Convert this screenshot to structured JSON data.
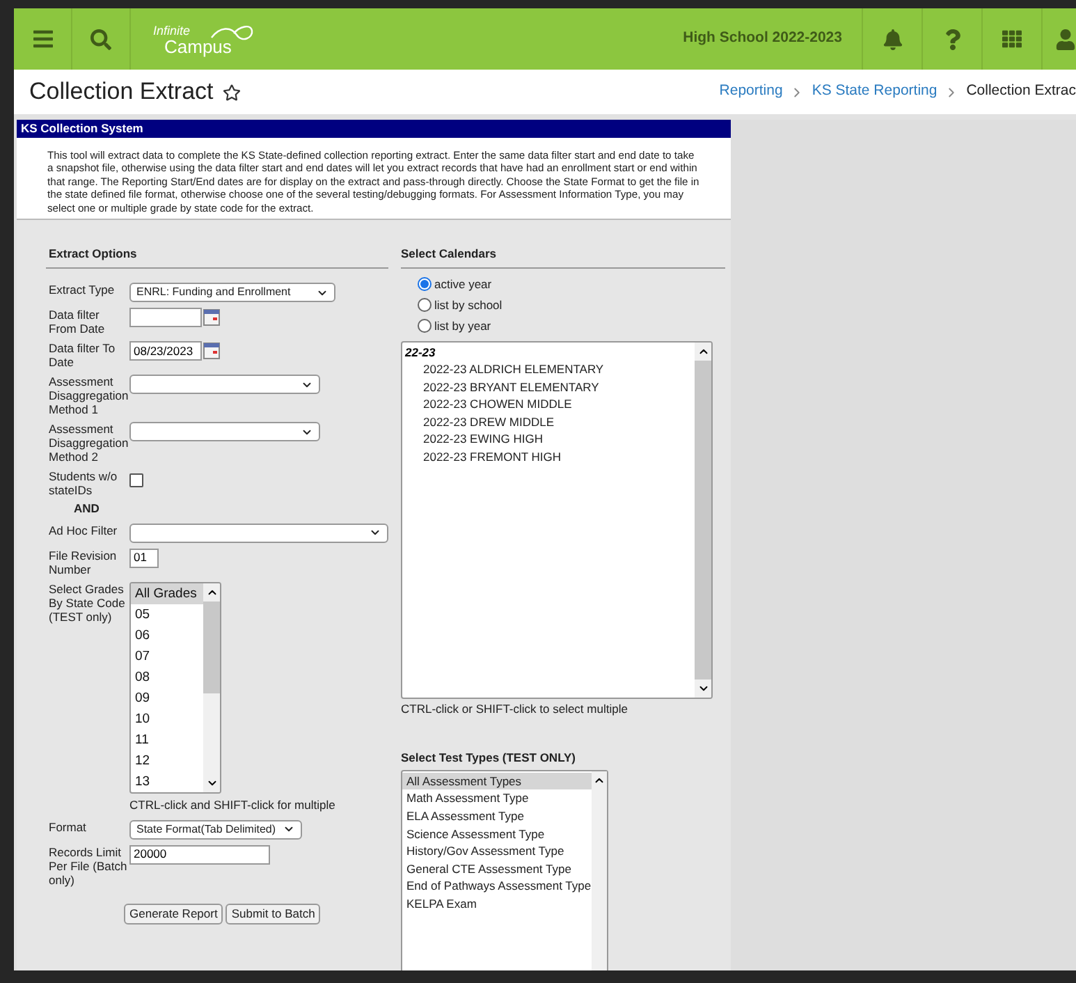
{
  "header": {
    "logo_top": "Infinite",
    "logo_bottom": "Campus",
    "school": "High School 2022-2023"
  },
  "page": {
    "title": "Collection Extract",
    "favorite": false,
    "breadcrumbs": [
      {
        "label": "Reporting",
        "link": true
      },
      {
        "label": "KS State Reporting",
        "link": true
      },
      {
        "label": "Collection Extrac",
        "link": false
      }
    ]
  },
  "panel": {
    "title": "KS Collection System",
    "description": "This tool will extract data to complete the KS State-defined collection reporting extract. Enter the same data filter start and end date to take a snapshot file, otherwise using the data filter start and end dates will let you extract records that have had an enrollment start or end within that range. The Reporting Start/End dates are for display on the extract and pass-through directly. Choose the State Format to get the file in the state defined file format, otherwise choose one of the several testing/debugging formats. For Assessment Information Type, you may select one or multiple grade by state code for the extract."
  },
  "extract_options": {
    "heading": "Extract Options",
    "fields": [
      {
        "kind": "select",
        "label": "Extract Type",
        "value": "ENRL: Funding and Enrollment"
      },
      {
        "kind": "date",
        "label": "Data filter From Date"
      },
      {
        "kind": "date",
        "label": "Data filter To Date",
        "value": "08/23/2023"
      },
      {
        "kind": "select",
        "label": "Assessment Disaggregation Method 1"
      },
      {
        "kind": "select",
        "label": "Assessment Disaggregation Method 2"
      },
      {
        "kind": "checkbox",
        "label": "Students w/o stateIDs",
        "checked": false
      },
      {
        "kind": "connector",
        "label": "AND"
      },
      {
        "kind": "select",
        "label": "Ad Hoc Filter"
      },
      {
        "kind": "text",
        "label": "File Revision Number",
        "value": "01"
      },
      {
        "kind": "listbox",
        "label": "Select Grades By State Code (TEST only)",
        "note": "CTRL-click and SHIFT-click for multiple",
        "options": [
          {
            "label": "All Grades",
            "selected": true
          },
          {
            "label": "05",
            "selected": false
          },
          {
            "label": "06",
            "selected": false
          },
          {
            "label": "07",
            "selected": false
          },
          {
            "label": "08",
            "selected": false
          },
          {
            "label": "09",
            "selected": false
          },
          {
            "label": "10",
            "selected": false
          },
          {
            "label": "11",
            "selected": false
          },
          {
            "label": "12",
            "selected": false
          },
          {
            "label": "13",
            "selected": false
          }
        ]
      },
      {
        "kind": "select",
        "label": "Format",
        "value": "State Format(Tab Delimited)"
      },
      {
        "kind": "text",
        "label": "Records Limit Per File (Batch only)",
        "value": "20000"
      }
    ],
    "buttons": [
      "Generate Report",
      "Submit to Batch"
    ]
  },
  "calendars": {
    "heading": "Select Calendars",
    "modes": [
      {
        "label": "active year",
        "selected": true
      },
      {
        "label": "list by school",
        "selected": false
      },
      {
        "label": "list by year",
        "selected": false
      }
    ],
    "groups": [
      {
        "label": "22-23",
        "items": [
          {
            "label": "2022-23 ALDRICH ELEMENTARY",
            "selected": false
          },
          {
            "label": "2022-23 BRYANT ELEMENTARY",
            "selected": false
          },
          {
            "label": "2022-23 CHOWEN MIDDLE",
            "selected": false
          },
          {
            "label": "2022-23 DREW MIDDLE",
            "selected": false
          },
          {
            "label": "2022-23 EWING HIGH",
            "selected": false
          },
          {
            "label": "2022-23 FREMONT HIGH",
            "selected": false
          }
        ]
      }
    ],
    "note": "CTRL-click or SHIFT-click to select multiple"
  },
  "test_types": {
    "heading": "Select Test Types (TEST ONLY)",
    "options": [
      {
        "label": "All Assessment Types",
        "selected": true
      },
      {
        "label": "Math Assessment Type",
        "selected": false
      },
      {
        "label": "ELA Assessment Type",
        "selected": false
      },
      {
        "label": "Science Assessment Type",
        "selected": false
      },
      {
        "label": "History/Gov Assessment Type",
        "selected": false
      },
      {
        "label": "General CTE Assessment Type",
        "selected": false
      },
      {
        "label": "End of Pathways Assessment Type",
        "selected": false
      },
      {
        "label": "KELPA Exam",
        "selected": false
      }
    ]
  }
}
